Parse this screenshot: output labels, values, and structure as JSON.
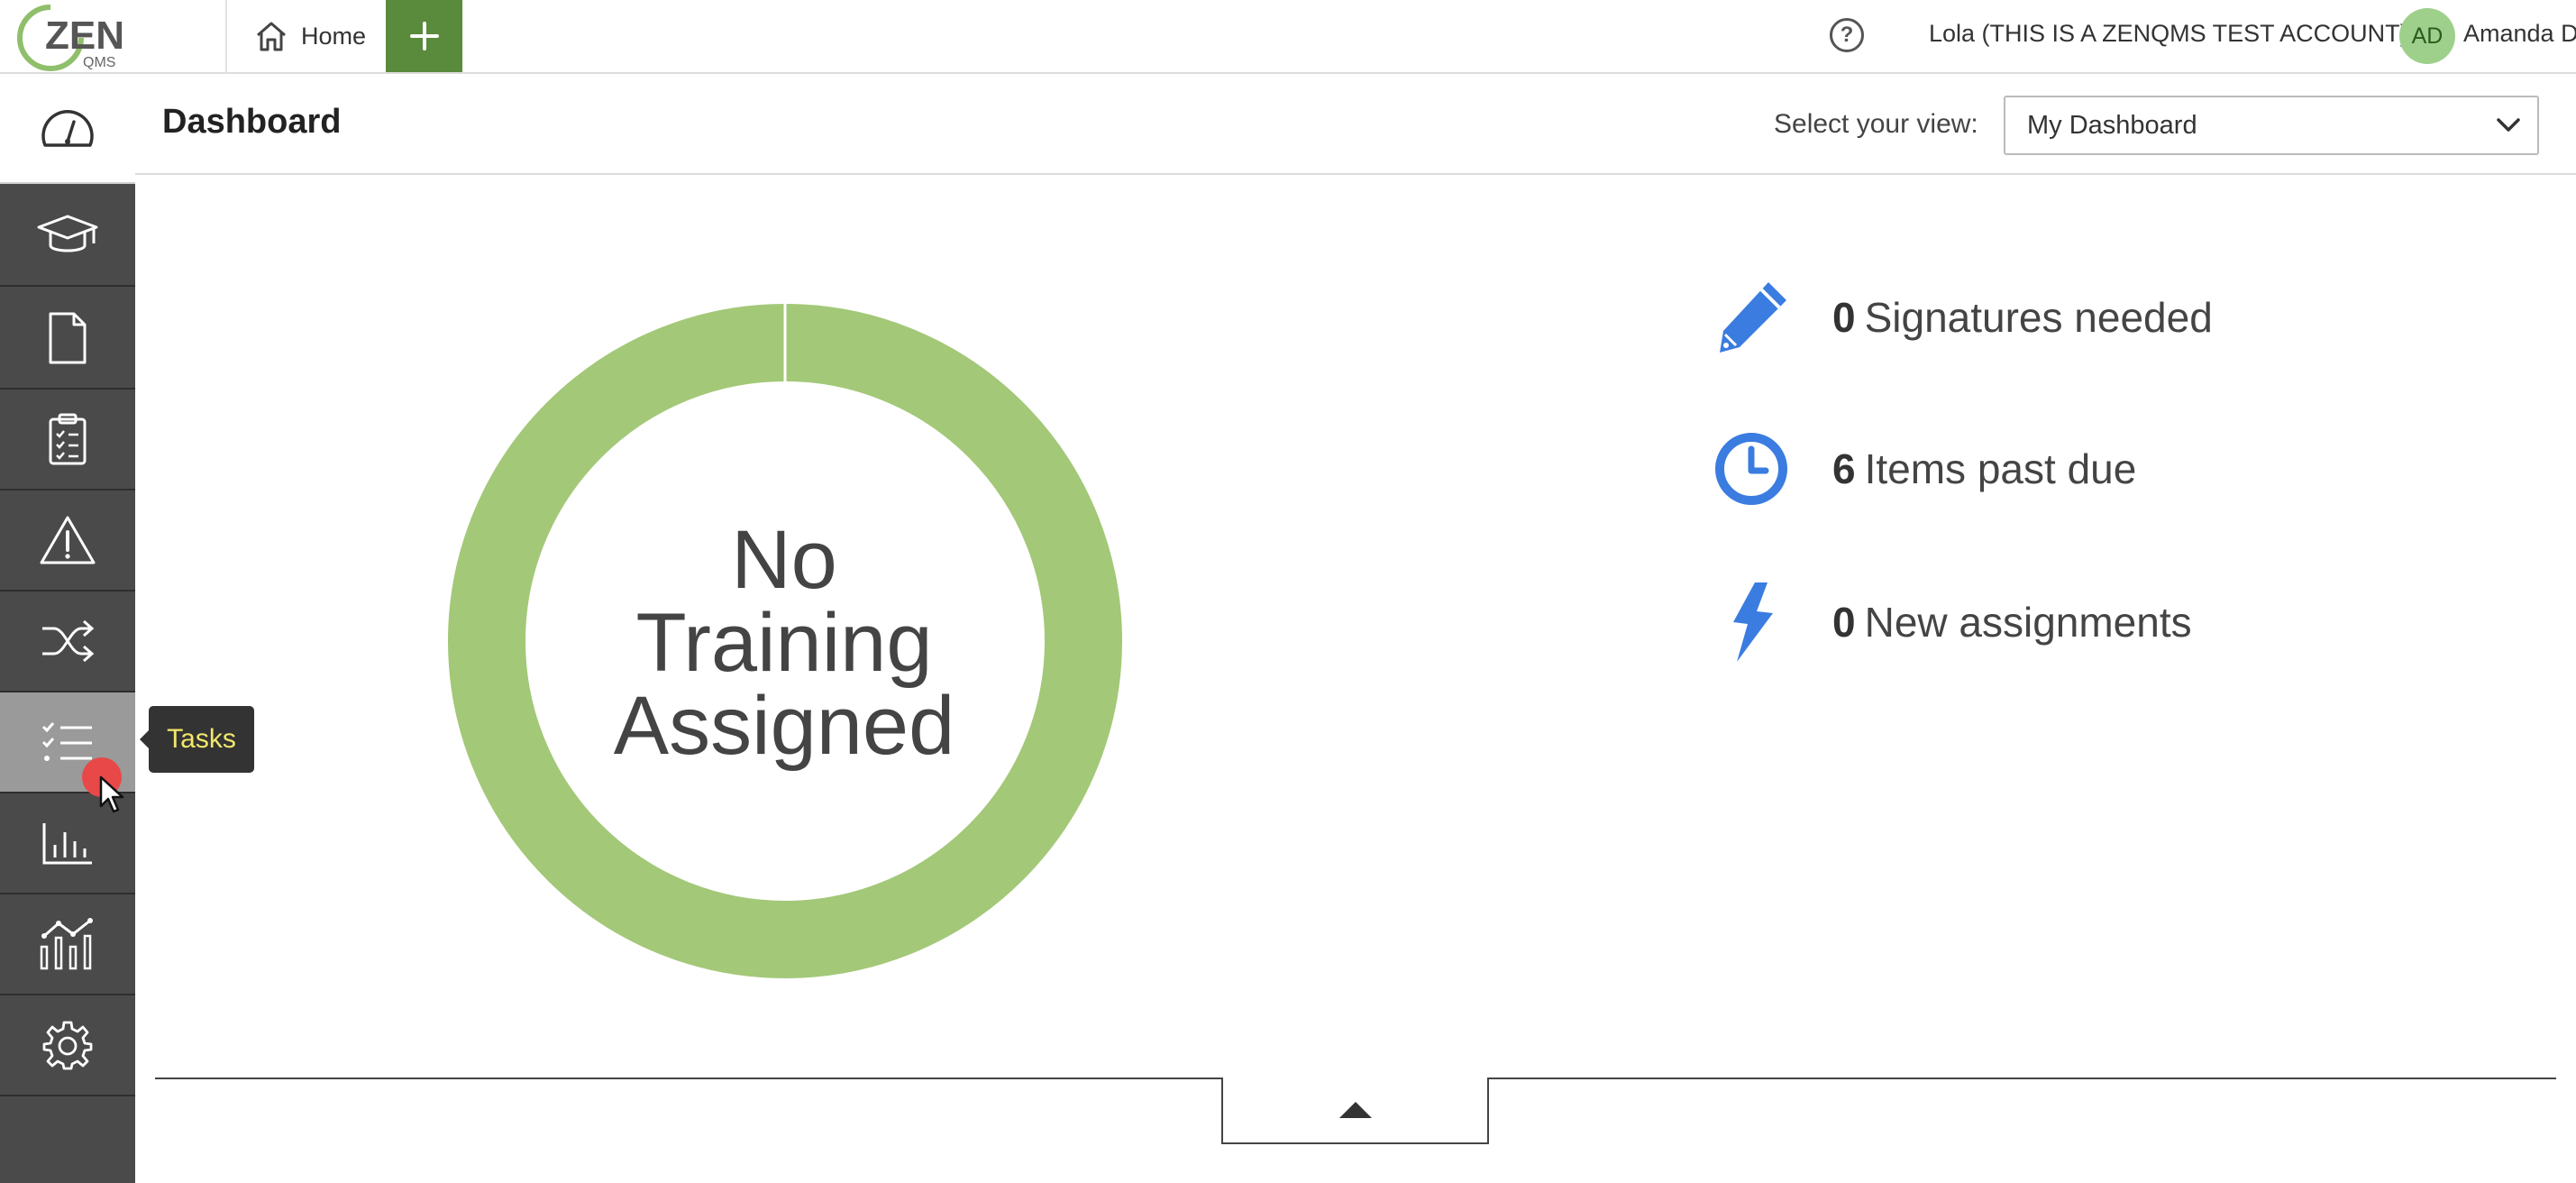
{
  "topbar": {
    "logo_text": "ZEN",
    "logo_subtext": "QMS",
    "home_label": "Home",
    "help_symbol": "?",
    "account_label": "Lola (THIS IS A ZENQMS TEST ACCOUNT)",
    "avatar_initials": "AD",
    "user_name": "Amanda D"
  },
  "sidebar": {
    "items": [
      {
        "name": "dashboard",
        "icon": "speedometer-icon"
      },
      {
        "name": "training",
        "icon": "graduation-cap-icon"
      },
      {
        "name": "documents",
        "icon": "document-icon"
      },
      {
        "name": "audits",
        "icon": "clipboard-checklist-icon"
      },
      {
        "name": "issues",
        "icon": "warning-icon"
      },
      {
        "name": "change-control",
        "icon": "shuffle-icon"
      },
      {
        "name": "tasks",
        "icon": "checklist-icon"
      },
      {
        "name": "reports",
        "icon": "bar-chart-icon"
      },
      {
        "name": "analytics",
        "icon": "line-bar-chart-icon"
      },
      {
        "name": "settings",
        "icon": "gear-icon"
      }
    ],
    "tooltip": "Tasks"
  },
  "header": {
    "title": "Dashboard",
    "view_label": "Select your view:",
    "view_selected": "My Dashboard"
  },
  "training_chart": {
    "line1": "No",
    "line2": "Training",
    "line3": "Assigned",
    "color": "#a3c878"
  },
  "stats": [
    {
      "count": "0",
      "label": "Signatures needed",
      "icon": "pencil-icon"
    },
    {
      "count": "6",
      "label": "Items past due",
      "icon": "clock-icon"
    },
    {
      "count": "0",
      "label": "New assignments",
      "icon": "lightning-icon"
    }
  ],
  "colors": {
    "accent_green": "#5a8a3c",
    "sidebar_bg": "#4a4a4a",
    "icon_blue": "#3a7ce0"
  }
}
